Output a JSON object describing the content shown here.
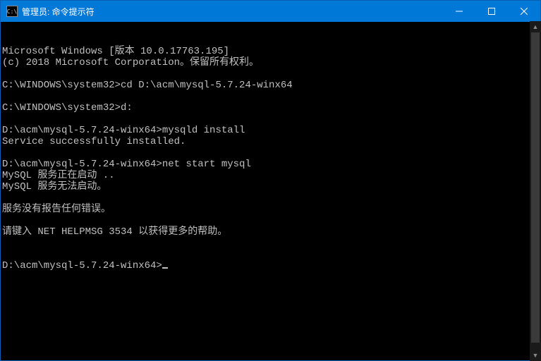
{
  "titlebar": {
    "icon_text": "C:\\",
    "title": "管理员: 命令提示符"
  },
  "terminal": {
    "lines": [
      "Microsoft Windows [版本 10.0.17763.195]",
      "(c) 2018 Microsoft Corporation。保留所有权利。",
      "",
      "C:\\WINDOWS\\system32>cd D:\\acm\\mysql-5.7.24-winx64",
      "",
      "C:\\WINDOWS\\system32>d:",
      "",
      "D:\\acm\\mysql-5.7.24-winx64>mysqld install",
      "Service successfully installed.",
      "",
      "D:\\acm\\mysql-5.7.24-winx64>net start mysql",
      "MySQL 服务正在启动 ..",
      "MySQL 服务无法启动。",
      "",
      "服务没有报告任何错误。",
      "",
      "请键入 NET HELPMSG 3534 以获得更多的帮助。",
      "",
      ""
    ],
    "prompt": "D:\\acm\\mysql-5.7.24-winx64>"
  }
}
